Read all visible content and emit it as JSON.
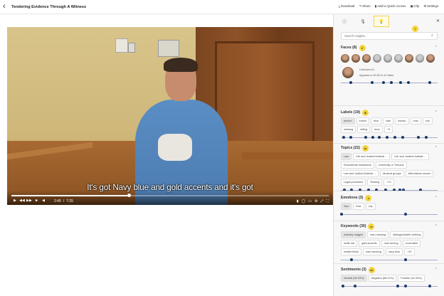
{
  "topbar": {
    "title": "Tendering Evidence Through A Witness",
    "actions": [
      {
        "icon": "download-icon",
        "glyph": "⤓",
        "label": "Download"
      },
      {
        "icon": "share-icon",
        "glyph": "↷",
        "label": "Share"
      },
      {
        "icon": "bookmark-icon",
        "glyph": "▮",
        "label": "Add to Quick Access"
      },
      {
        "icon": "clip-icon",
        "glyph": "▣",
        "label": "Clip"
      },
      {
        "icon": "gear-icon",
        "glyph": "⚙",
        "label": "Settings"
      }
    ]
  },
  "video": {
    "subtitle": "It's got Navy blue and gold accents and it's got",
    "current_time": "2:45",
    "separator": "/",
    "duration": "7:25",
    "progress_fraction": 0.37
  },
  "panel": {
    "tab_badge": "i",
    "search": {
      "placeholder": "Search insights..."
    },
    "faces": {
      "title": "Faces (8)",
      "badge": "ii",
      "unknown_label": "Unknown #1",
      "appears": "Appears in 40.95 % of Video",
      "markers": [
        0.1,
        0.32,
        0.44,
        0.52,
        0.62,
        0.7,
        0.92
      ]
    },
    "labels": {
      "title": "Labels (19)",
      "badge": "iii",
      "items": [
        "person",
        "indoor",
        "blue",
        "wall",
        "human",
        "man",
        "suit",
        "wearing",
        "sitting",
        "door",
        "+9"
      ],
      "markers": [
        0.03,
        0.1,
        0.26,
        0.33,
        0.4,
        0.48,
        0.56,
        0.64,
        0.8,
        0.88
      ]
    },
    "topics": {
      "title": "Topics (22)",
      "badge": "iv",
      "items": [
        "Law",
        "Life and Justice/Judicial ...",
        "Life and Justice/Judicial ...",
        "Educational institutions",
        "University or Tribunal",
        "Law and Justice/Judicial ...",
        "Musical groups",
        "Attendance moves",
        "Legal procedure",
        "Ruining",
        "+12"
      ],
      "markers": [
        0.04,
        0.11,
        0.2,
        0.29,
        0.37,
        0.46,
        0.55,
        0.61,
        0.65,
        0.82
      ]
    },
    "emotions": {
      "title": "Emotions (3)",
      "badge": "v",
      "items": [
        "Sad",
        "Fear",
        "Joy"
      ],
      "markers": [
        0.01,
        0.67
      ]
    },
    "keywords": {
      "title": "Keywords (30)",
      "badge": "vi",
      "items": [
        "ordinary magpie",
        "man carrying",
        "distinguishable clothing",
        "white hat",
        "gold accents",
        "man turning",
        "court table",
        "middle finish",
        "man wearing",
        "navy blue",
        "+20"
      ],
      "markers": [
        0.11,
        0.67
      ]
    },
    "sentiments": {
      "title": "Sentiments (3)",
      "badge": "vii",
      "items": [
        "Neutral (59.93%)",
        "Negative (68.21%)",
        "Positive (31.99%)"
      ],
      "markers": [
        0.02,
        0.15,
        0.59,
        0.67,
        0.92
      ]
    }
  }
}
